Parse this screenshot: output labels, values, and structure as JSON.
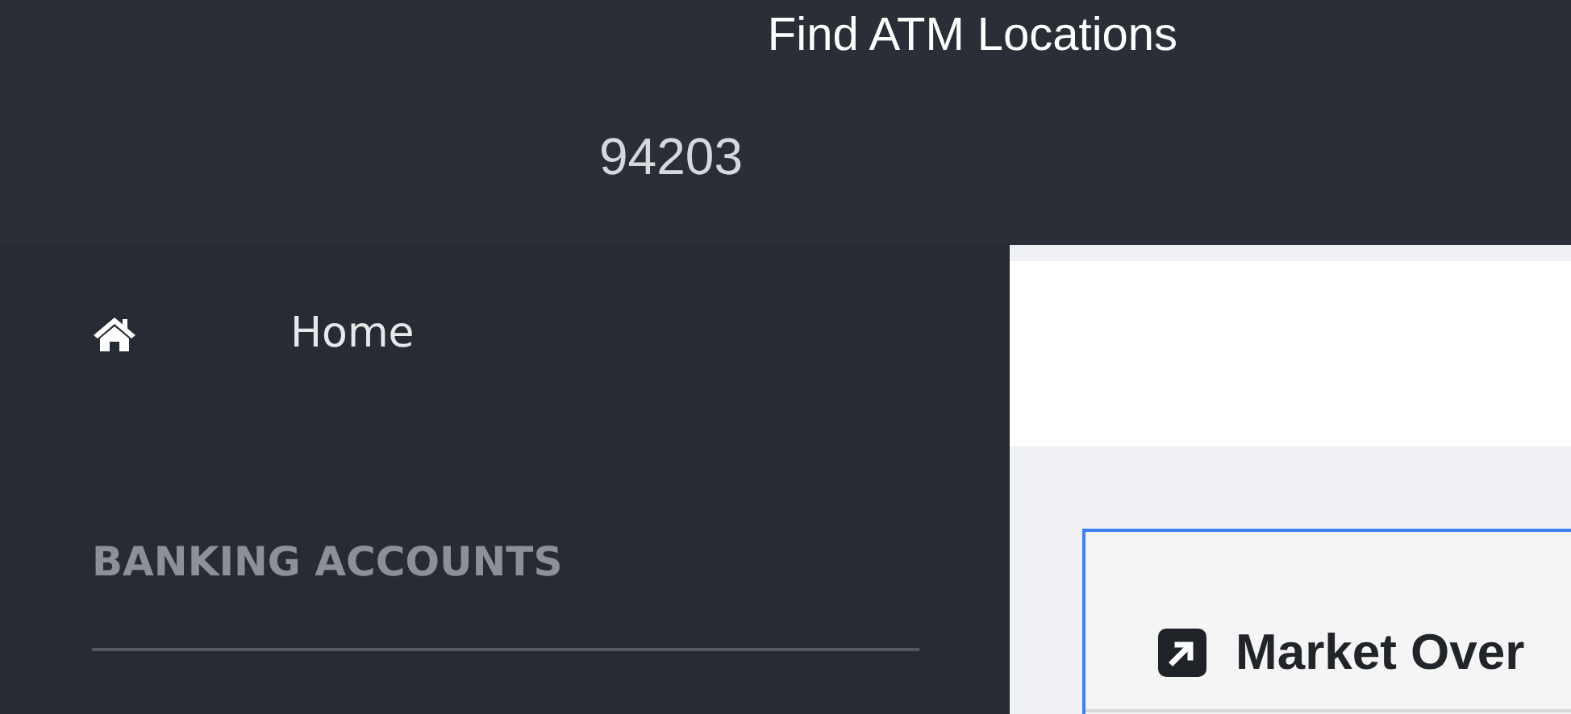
{
  "header": {
    "title": "Find ATM Locations",
    "zip_code": "94203"
  },
  "sidebar": {
    "items": [
      {
        "label": "Home",
        "selected": false
      }
    ],
    "section_heading": "BANKING ACCOUNTS"
  },
  "main": {
    "card": {
      "title": "Market Over"
    }
  }
}
